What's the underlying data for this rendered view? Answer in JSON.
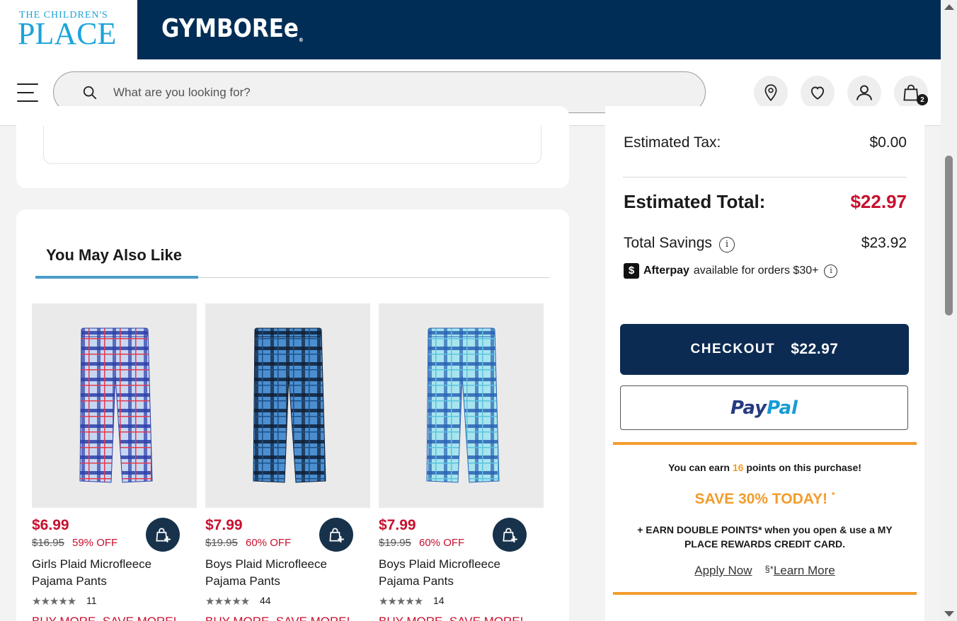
{
  "brand": {
    "tcp_line1": "THE CHILDREN'S",
    "tcp_line2": "PLACE",
    "gymboree": "GYMBOREe",
    "gymboree_mark": "®"
  },
  "header": {
    "search_placeholder": "What are you looking for?",
    "cart_count": "2",
    "icons": [
      "store-locator-icon",
      "heart-icon",
      "account-icon",
      "shopping-bag-icon"
    ]
  },
  "recommendations": {
    "title": "You May Also Like",
    "products": [
      {
        "price": "$6.99",
        "original_price": "$16.95",
        "discount": "59% OFF",
        "name": "Girls Plaid Microfleece Pajama Pants",
        "stars": "★★★★★",
        "reviews": "11",
        "promo": "BUY MORE, SAVE MORE!",
        "colors": {
          "base": "#c7d7f2",
          "stripe": "#2c3fa8",
          "accent": "#e33b4e"
        }
      },
      {
        "price": "$7.99",
        "original_price": "$19.95",
        "discount": "60% OFF",
        "name": "Boys Plaid Microfleece Pajama Pants",
        "stars": "★★★★★",
        "reviews": "44",
        "promo": "BUY MORE, SAVE MORE!",
        "colors": {
          "base": "#4b8fd1",
          "stripe": "#0f1e35",
          "accent": "#1d4f86"
        }
      },
      {
        "price": "$7.99",
        "original_price": "$19.95",
        "discount": "60% OFF",
        "name": "Boys Plaid Microfleece Pajama Pants",
        "stars": "★★★★★",
        "reviews": "14",
        "promo": "BUY MORE, SAVE MORE!",
        "colors": {
          "base": "#a8e4ee",
          "stripe": "#2b63b5",
          "accent": "#5ac3de"
        }
      }
    ]
  },
  "summary": {
    "tax_label": "Estimated Tax:",
    "tax_value": "$0.00",
    "total_label": "Estimated Total:",
    "total_value": "$22.97",
    "savings_label": "Total Savings",
    "savings_value": "$23.92",
    "afterpay_name": "Afterpay",
    "afterpay_text": "available for orders $30+",
    "checkout_label": "CHECKOUT",
    "checkout_amount": "$22.97",
    "paypal_1": "Pay",
    "paypal_2": "Pal"
  },
  "rewards": {
    "earn_prefix": "You can earn",
    "earn_points": "16",
    "earn_suffix": "points on this purchase!",
    "save_title": "SAVE 30% TODAY!",
    "save_mark": "*",
    "double_points": "+ EARN DOUBLE POINTS* when you open & use a MY PLACE REWARDS CREDIT CARD.",
    "apply_now": "Apply Now",
    "section_mark": "§*",
    "learn_more": "Learn More"
  },
  "colors": {
    "brand_navy": "#002d56",
    "price_red": "#c8102e",
    "rewards_orange": "#f39c2b",
    "checkout_navy": "#0c2b52"
  }
}
